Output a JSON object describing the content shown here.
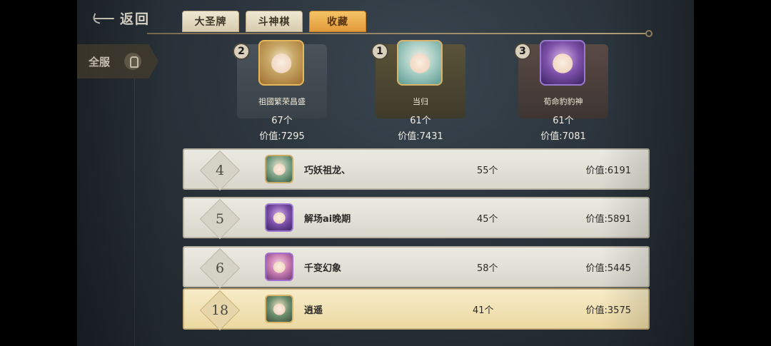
{
  "header": {
    "back_label": "返回",
    "tabs": [
      {
        "label": "大圣牌",
        "active": false
      },
      {
        "label": "斗神棋",
        "active": false
      },
      {
        "label": "收藏",
        "active": true
      }
    ]
  },
  "server_filter": {
    "label": "全服",
    "icon": "microphone-icon"
  },
  "top3": [
    {
      "rank": "2",
      "name": "祖國繁荣昌盛",
      "count": "67个",
      "value": "价值:7295"
    },
    {
      "rank": "1",
      "name": "当归",
      "count": "61个",
      "value": "价值:7431"
    },
    {
      "rank": "3",
      "name": "荀命豹豹神",
      "count": "61个",
      "value": "价值:7081"
    }
  ],
  "rows": [
    {
      "rank": "4",
      "name": "巧妖祖龙、",
      "count": "55个",
      "value": "价值:6191"
    },
    {
      "rank": "5",
      "name": "解场ai晚期",
      "count": "45个",
      "value": "价值:5891"
    },
    {
      "rank": "6",
      "name": "千变幻象",
      "count": "58个",
      "value": "价值:5445"
    },
    {
      "rank": "18",
      "name": "逍遥",
      "count": "41个",
      "value": "价值:3575",
      "is_me": true
    }
  ],
  "colors": {
    "active_tab": "#e29a3a",
    "row_background": "#ebeae2",
    "my_row_background": "#f7ecc8"
  }
}
